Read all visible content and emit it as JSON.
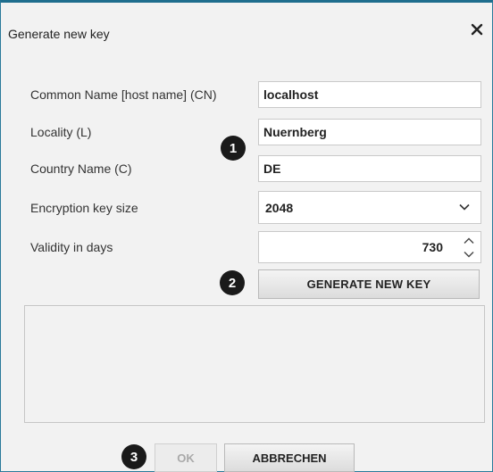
{
  "dialog": {
    "title": "Generate new key",
    "close_icon": "close-icon"
  },
  "form": {
    "common_name": {
      "label": "Common Name [host name] (CN)",
      "value": "localhost"
    },
    "locality": {
      "label": "Locality (L)",
      "value": "Nuernberg"
    },
    "country": {
      "label": "Country Name (C)",
      "value": "DE"
    },
    "key_size": {
      "label": "Encryption key size",
      "selected": "2048"
    },
    "validity": {
      "label": "Validity in days",
      "value": "730"
    }
  },
  "buttons": {
    "generate": "GENERATE NEW KEY",
    "ok": "OK",
    "cancel": "ABBRECHEN"
  },
  "callouts": [
    "1",
    "2",
    "3"
  ],
  "colors": {
    "dialog_border": "#1f6e8e",
    "background": "#f2f2f2",
    "badge": "#1a1a1a",
    "disabled_text": "#a9a9a9"
  }
}
